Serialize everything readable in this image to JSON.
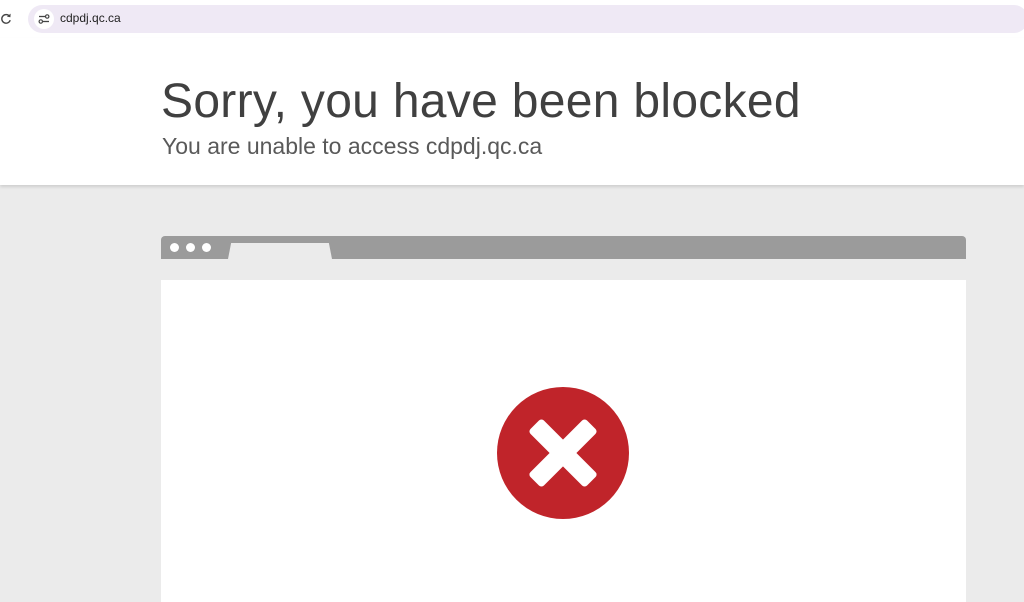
{
  "browser": {
    "url": "cdpdj.qc.ca",
    "reload_icon": "reload-icon",
    "site_info_icon": "site-info-icon"
  },
  "page": {
    "title": "Sorry, you have been blocked",
    "subtitle": "You are unable to access cdpdj.qc.ca"
  },
  "illustration": {
    "icon": "error-x-icon",
    "icon_color": "#c0242a",
    "frame_color": "#9b9b9b",
    "background_color": "#ebebeb"
  }
}
